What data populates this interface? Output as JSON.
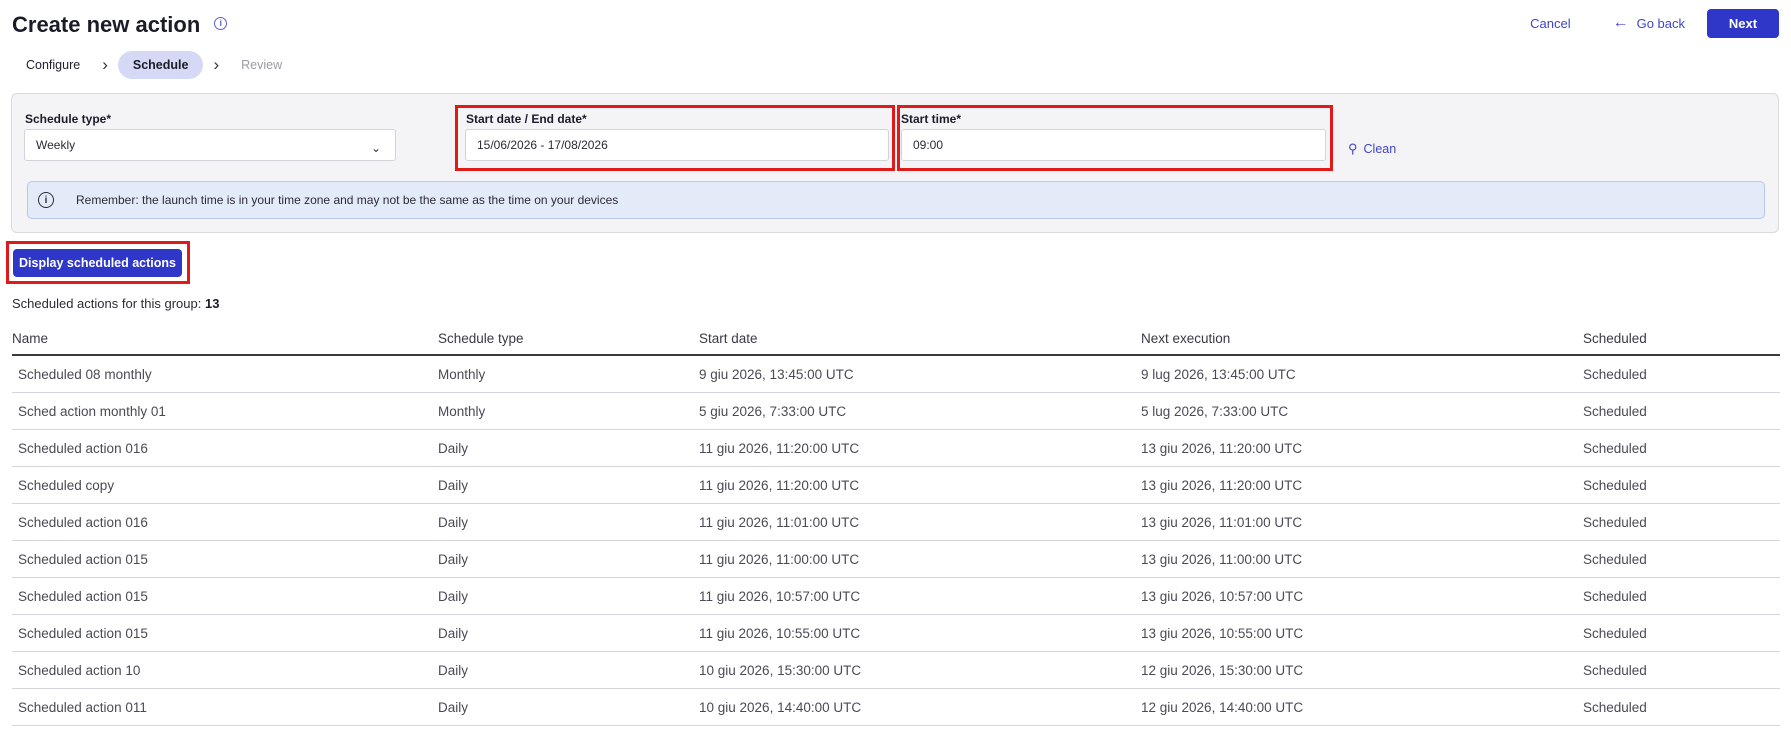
{
  "header": {
    "title": "Create new action",
    "cancel_label": "Cancel",
    "go_back_label": "Go back",
    "next_label": "Next"
  },
  "stepper": {
    "steps": [
      {
        "label": "Configure",
        "state": "done"
      },
      {
        "label": "Schedule",
        "state": "active"
      },
      {
        "label": "Review",
        "state": "disabled"
      }
    ]
  },
  "form": {
    "schedule_type_label": "Schedule type*",
    "schedule_type_value": "Weekly",
    "date_range_label": "Start date / End date*",
    "date_range_value": "15/06/2026 - 17/08/2026",
    "start_time_label": "Start time*",
    "start_time_value": "09:00",
    "clean_label": "Clean",
    "notice_text": "Remember: the launch time is in your time zone and may not be the same as the time on your devices"
  },
  "display_button_label": "Display scheduled actions",
  "summary": {
    "prefix": "Scheduled actions for this group:",
    "count": "13"
  },
  "table": {
    "columns": [
      "Name",
      "Schedule type",
      "Start date",
      "Next execution",
      "Scheduled"
    ],
    "rows": [
      [
        "Scheduled 08 monthly",
        "Monthly",
        "9 giu 2026, 13:45:00 UTC",
        "9 lug 2026, 13:45:00 UTC",
        "Scheduled"
      ],
      [
        "Sched action monthly 01",
        "Monthly",
        "5 giu 2026, 7:33:00 UTC",
        "5 lug 2026, 7:33:00 UTC",
        "Scheduled"
      ],
      [
        "Scheduled action 016",
        "Daily",
        "11 giu 2026, 11:20:00 UTC",
        "13 giu 2026, 11:20:00 UTC",
        "Scheduled"
      ],
      [
        "Scheduled copy",
        "Daily",
        "11 giu 2026, 11:20:00 UTC",
        "13 giu 2026, 11:20:00 UTC",
        "Scheduled"
      ],
      [
        "Scheduled action 016",
        "Daily",
        "11 giu 2026, 11:01:00 UTC",
        "13 giu 2026, 11:01:00 UTC",
        "Scheduled"
      ],
      [
        "Scheduled action 015",
        "Daily",
        "11 giu 2026, 11:00:00 UTC",
        "13 giu 2026, 11:00:00 UTC",
        "Scheduled"
      ],
      [
        "Scheduled action 015",
        "Daily",
        "11 giu 2026, 10:57:00 UTC",
        "13 giu 2026, 10:57:00 UTC",
        "Scheduled"
      ],
      [
        "Scheduled action 015",
        "Daily",
        "11 giu 2026, 10:55:00 UTC",
        "13 giu 2026, 10:55:00 UTC",
        "Scheduled"
      ],
      [
        "Scheduled action 10",
        "Daily",
        "10 giu 2026, 15:30:00 UTC",
        "12 giu 2026, 15:30:00 UTC",
        "Scheduled"
      ],
      [
        "Scheduled action 011",
        "Daily",
        "10 giu 2026, 14:40:00 UTC",
        "12 giu 2026, 14:40:00 UTC",
        "Scheduled"
      ]
    ]
  },
  "colors": {
    "primary": "#2f37c8",
    "link": "#3e46c8",
    "highlight": "#e01919",
    "notice_bg": "#e4ebf8"
  }
}
